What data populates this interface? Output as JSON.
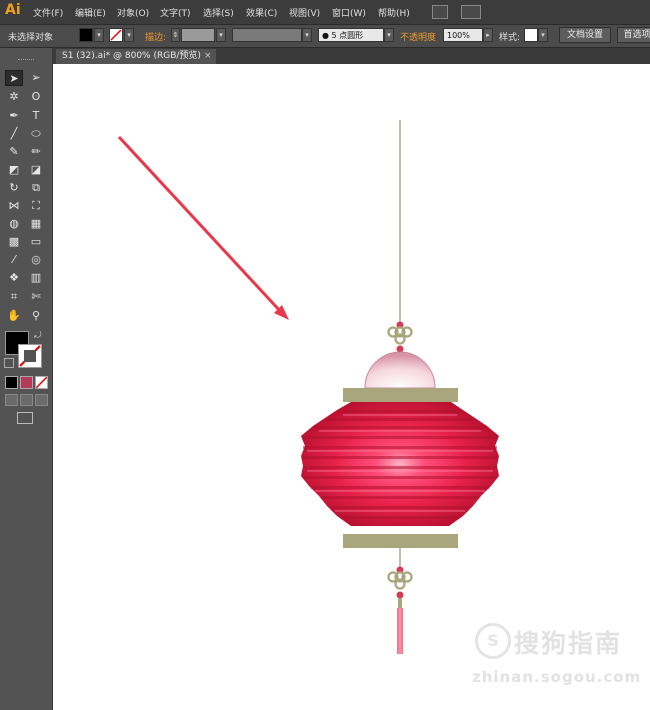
{
  "app": {
    "logo": "Ai"
  },
  "menu": [
    "文件(F)",
    "编辑(E)",
    "对象(O)",
    "文字(T)",
    "选择(S)",
    "效果(C)",
    "视图(V)",
    "窗口(W)",
    "帮助(H)"
  ],
  "control_bar": {
    "selection_status": "未选择对象",
    "stroke_label": "描边:",
    "brush_value": "5 点圆形",
    "opacity_label": "不透明度",
    "opacity_value": "100%",
    "style_label": "样式:",
    "doc_setup_button": "文档设置",
    "prefs_button": "首选项"
  },
  "document_tab": {
    "title": "S1 (32).ai* @ 800% (RGB/预览)",
    "close": "×"
  },
  "colors": {
    "fill": "#000000",
    "stroke": "none",
    "lantern_red": "#e8224a",
    "gold": "#a9a57c",
    "arrow": "#e8384a"
  },
  "watermark": {
    "logo_char": "S",
    "text": "搜狗指南",
    "url": "zhinan.sogou.com"
  }
}
